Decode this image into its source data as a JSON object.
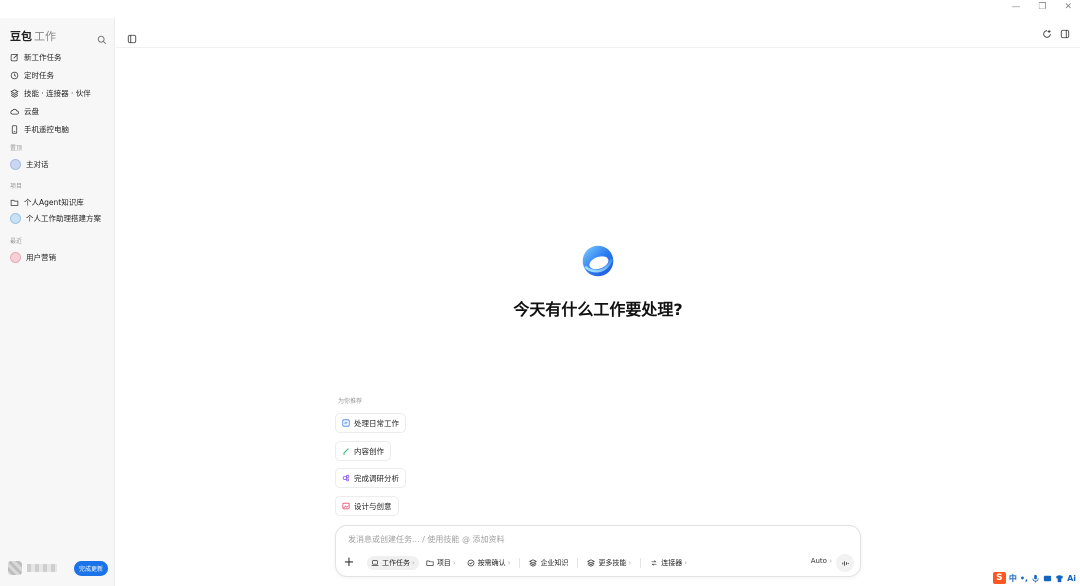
{
  "window": {
    "minimize": "—",
    "restore": "❐",
    "close": "✕"
  },
  "brand": {
    "name": "豆包",
    "sub": "工作"
  },
  "nav": [
    {
      "label": "新工作任务",
      "icon": "edit-icon"
    },
    {
      "label": "定时任务",
      "icon": "clock-icon"
    },
    {
      "label": "技能 · 连接器 · 伙伴",
      "icon": "skills-icon"
    },
    {
      "label": "云盘",
      "icon": "cloud-icon"
    },
    {
      "label": "手机遥控电脑",
      "icon": "phone-icon"
    }
  ],
  "sections": {
    "pinned": "置顶",
    "projects": "项目",
    "recent": "最近"
  },
  "pinned": [
    {
      "label": "主对话",
      "color": "#c9d7f2"
    }
  ],
  "projects": [
    {
      "label": "个人Agent知识库",
      "icon": "folder-icon"
    },
    {
      "label": "个人工作助理搭建方案",
      "color": "#c9e0f5"
    }
  ],
  "recent": [
    {
      "label": "用户营销",
      "color": "#f6d0d6"
    }
  ],
  "user": {
    "upgrade_label": "完成更新"
  },
  "main": {
    "greeting": "今天有什么工作要处理?"
  },
  "recommend": {
    "label": "为你推荐",
    "chips": [
      {
        "label": "处理日常工作",
        "color": "#3b7be8"
      },
      {
        "label": "内容创作",
        "color": "#2bb673"
      },
      {
        "label": "完成调研分析",
        "color": "#8a5cf6"
      },
      {
        "label": "设计与创意",
        "color": "#e8506f"
      }
    ]
  },
  "composer": {
    "placeholder": "发消息或创建任务... / 使用技能 @ 添加资料",
    "plus": "+",
    "tools": [
      {
        "label": "工作任务",
        "chevron": "›",
        "active": true
      },
      {
        "label": "项目",
        "chevron": "›"
      },
      {
        "label": "按需确认",
        "chevron": "›"
      },
      {
        "label": "企业知识",
        "chevron": ""
      },
      {
        "label": "更多技能",
        "chevron": "›"
      },
      {
        "label": "连接器",
        "chevron": "›"
      }
    ],
    "mode": "Auto",
    "mode_chevron": "›"
  },
  "ime": {
    "logo": "S",
    "lang": "中",
    "punct": "•,",
    "ai": "Ai"
  }
}
